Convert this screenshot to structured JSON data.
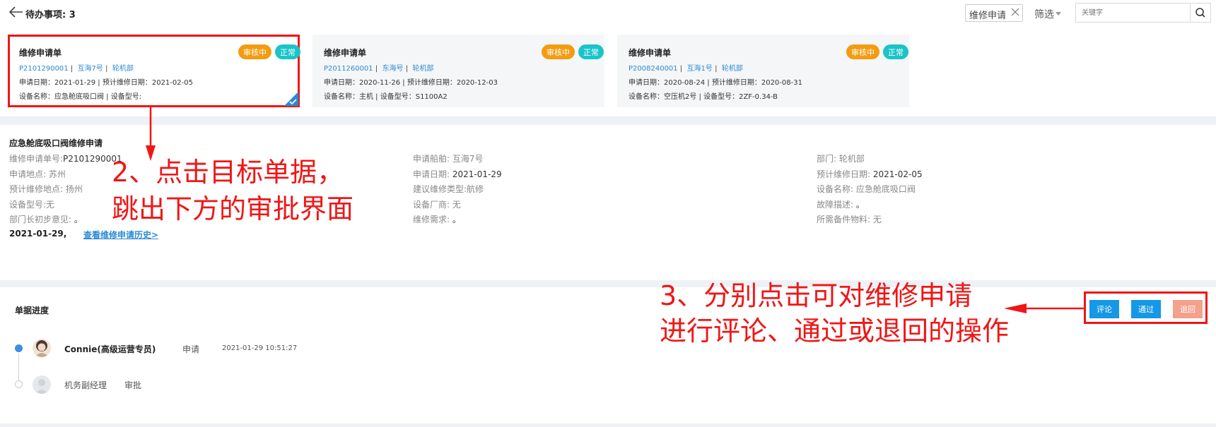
{
  "header": {
    "title": "待办事项: 3",
    "filter_tag": "维修申请",
    "filter_label": "筛选",
    "search_placeholder": "关键字"
  },
  "cards": [
    {
      "title": "维修申请单",
      "number": "P2101290001",
      "ship": "互海7号",
      "department": "轮机部",
      "apply_date": "申请日期：2021-01-29 | 预计维修日期：2021-02-05",
      "equipment": "设备名称：应急舱底吸口阀 | 设备型号:",
      "status_review": "审核中",
      "status_normal": "正常"
    },
    {
      "title": "维修申请单",
      "number": "P2011260001",
      "ship": "东海号",
      "department": "轮机部",
      "apply_date": "申请日期：2020-11-26 | 预计维修日期：2020-12-03",
      "equipment": "设备名称：主机 | 设备型号：S1100A2",
      "status_review": "审核中",
      "status_normal": "正常"
    },
    {
      "title": "维修申请单",
      "number": "P2008240001",
      "ship": "互海1号",
      "department": "轮机部",
      "apply_date": "申请日期：2020-08-24 | 预计维修日期：2020-08-31",
      "equipment": "设备名称：空压机2号 | 设备型号：2ZF-0.34-B",
      "status_review": "审核中",
      "status_normal": "正常"
    }
  ],
  "detail": {
    "title": "应急舱底吸口阀维修申请",
    "col1": [
      {
        "label": "维修申请单号:",
        "value": "P2101290001"
      },
      {
        "label": "申请地点:",
        "value": " 苏州"
      },
      {
        "label": "预计维修地点:",
        "value": " 扬州"
      },
      {
        "label": "设备型号:",
        "value": "无"
      },
      {
        "label": "部门长初步意见:",
        "value": " 。"
      }
    ],
    "col2": [
      {
        "label": "申请船舶:",
        "value": " 互海7号"
      },
      {
        "label": "申请日期:",
        "value": " 2021-01-29"
      },
      {
        "label": "建议维修类型:",
        "value": "航修"
      },
      {
        "label": "设备厂商:",
        "value": " 无"
      },
      {
        "label": "维修需求:",
        "value": " 。"
      }
    ],
    "col3": [
      {
        "label": "部门:",
        "value": " 轮机部"
      },
      {
        "label": "预计维修日期:",
        "value": " 2021-02-05"
      },
      {
        "label": "设备名称:",
        "value": " 应急舱底吸口阀"
      },
      {
        "label": "故障描述:",
        "value": " 。"
      },
      {
        "label": "所需备件物料:",
        "value": " 无"
      }
    ],
    "date": "2021-01-29,",
    "history_link": "查看维修申请历史>"
  },
  "progress": {
    "title": "单据进度",
    "steps": [
      {
        "name": "Connie(高级运营专员)",
        "action": "申请",
        "time": "2021-01-29 10:51:27"
      },
      {
        "name": "机务副经理",
        "action": "审批"
      }
    ]
  },
  "actions": {
    "comment": "评论",
    "pass": "通过",
    "reject": "退回"
  },
  "annotations": {
    "step2_line1": "2、点击目标单据，",
    "step2_line2": "跳出下方的审批界面",
    "step3_line1": "3、分别点击可对维修申请",
    "step3_line2": "进行评论、通过或退回的操作"
  },
  "colors": {
    "accent_blue": "#1598e6",
    "link_blue": "#2a8ad6",
    "badge_review": "#f39c12",
    "badge_normal": "#1ac4c8",
    "reject": "#f3a08c",
    "annotation_red": "#f01616"
  }
}
